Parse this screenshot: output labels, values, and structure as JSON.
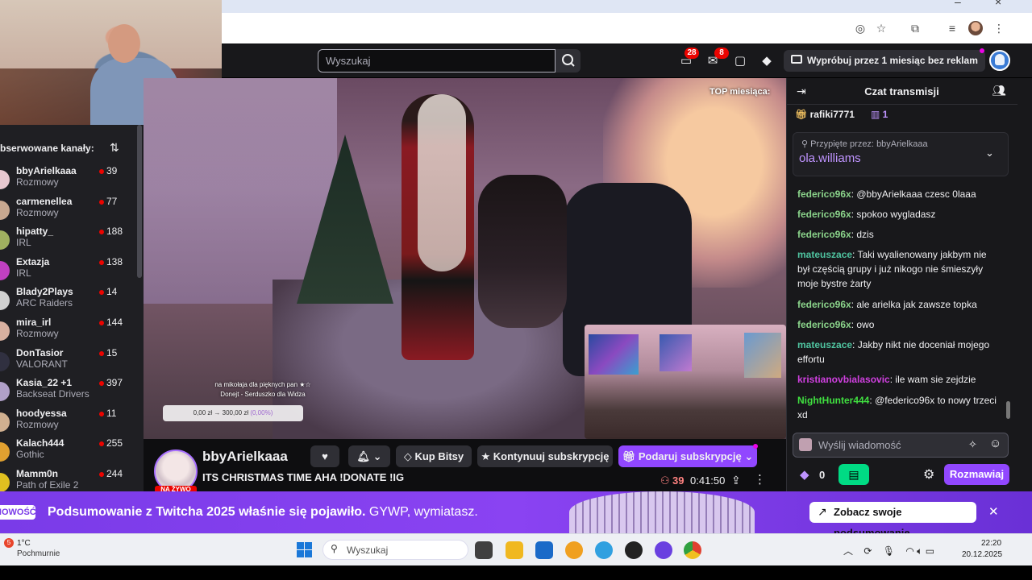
{
  "browser": {
    "icons": [
      "eye-off-icon",
      "star-icon",
      "extensions-icon",
      "media-icon",
      "profile-icon",
      "menu-icon"
    ]
  },
  "topnav": {
    "search_placeholder": "Wyszukaj",
    "notifications_count": "28",
    "inbox_count": "8",
    "trial_label": "Wypróbuj przez 1 miesiąc bez reklam"
  },
  "sidebar": {
    "header": "bserwowane kanały:",
    "channels": [
      {
        "name": "bbyArielkaaa",
        "category": "Rozmowy",
        "viewers": "39",
        "color": "#e8c8d0"
      },
      {
        "name": "carmenellea",
        "category": "Rozmowy",
        "viewers": "77",
        "color": "#c8a890"
      },
      {
        "name": "hipatty_",
        "category": "IRL",
        "viewers": "188",
        "color": "#a0b060"
      },
      {
        "name": "Extazja",
        "category": "IRL",
        "viewers": "138",
        "color": "#c040c0"
      },
      {
        "name": "Blady2Plays",
        "category": "ARC Raiders",
        "viewers": "14",
        "color": "#d0d0d0"
      },
      {
        "name": "mira_irl",
        "category": "Rozmowy",
        "viewers": "144",
        "color": "#d8b0a0"
      },
      {
        "name": "DonTasior",
        "category": "VALORANT",
        "viewers": "15",
        "color": "#303040"
      },
      {
        "name": "Kasia_22 +1",
        "category": "Backseat Drivers",
        "viewers": "397",
        "color": "#b0a0c8"
      },
      {
        "name": "hoodyessa",
        "category": "Rozmowy",
        "viewers": "11",
        "color": "#d0b090"
      },
      {
        "name": "Kalach444",
        "category": "Gothic",
        "viewers": "255",
        "color": "#e0a030"
      },
      {
        "name": "Mamm0n",
        "category": "Path of Exile 2",
        "viewers": "244",
        "color": "#e0c020"
      }
    ]
  },
  "video": {
    "top_title": "TOP miesiąca:",
    "goal_text_1": "na mikołaja dla pięknych pan ★☆",
    "goal_text_2": "Donejt - Serduszko dla Widza",
    "goal_progress": "0,00 zł → 300,00 zł",
    "goal_percent": "(0,00%)"
  },
  "stream": {
    "streamer": "bbyArielkaaa",
    "live_tag": "NA ŻYWO",
    "title": "ITS CHRISTMAS TIME AHA !DONATE !IG",
    "bits_label": "Kup Bitsy",
    "resub_label": "Kontynuuj subskrypcję",
    "gift_label": "Podaruj subskrypcję",
    "viewers": "39",
    "uptime": "0:41:50"
  },
  "chat": {
    "title": "Czat transmisji",
    "gifter": "rafiki7771",
    "gifter_count": "1",
    "pinned_by_label": "Przypięte przez:",
    "pinned_by": "bbyArielkaaa",
    "pinned_user": "ola.williams",
    "messages": [
      {
        "user": "federico96x",
        "text": ": @bbyArielkaaa czesc 0laaa",
        "color": "#8bd48b"
      },
      {
        "user": "federico96x",
        "text": ": spokoo wygladasz",
        "color": "#8bd48b"
      },
      {
        "user": "federico96x",
        "text": ": dzis",
        "color": "#8bd48b"
      },
      {
        "user": "mateuszace",
        "text": ": Taki wyalienowany jakbym nie był częścią grupy i już nikogo nie śmieszyły moje bystre żarty",
        "color": "#4fc4a0"
      },
      {
        "user": "federico96x",
        "text": ": ale arielka jak zawsze topka",
        "color": "#8bd48b"
      },
      {
        "user": "federico96x",
        "text": ": owo",
        "color": "#8bd48b"
      },
      {
        "user": "mateuszace",
        "text": ": Jakby nikt nie doceniał mojego effortu",
        "color": "#4fc4a0"
      },
      {
        "user": "kristianovbialasovic",
        "text": ": ile wam sie zejdzie",
        "color": "#d040e0"
      },
      {
        "user": "NightHunter444",
        "text": ": @federico96x to nowy trzeci xd",
        "color": "#40e040"
      }
    ],
    "input_placeholder": "Wyślij wiadomość",
    "points": "0",
    "send_label": "Rozmawiaj"
  },
  "banner": {
    "tag": "NOWOŚĆ",
    "text_bold": "Podsumowanie z Twitcha 2025 właśnie się pojawiło.",
    "text_rest": " GYWP, wymiatasz.",
    "button": "Zobacz swoje podsumowanie"
  },
  "taskbar": {
    "weather_badge": "5",
    "temperature": "1°C",
    "weather_desc": "Pochmurnie",
    "search_placeholder": "Wyszukaj",
    "time": "22:20",
    "date": "20.12.2025"
  },
  "colors": {
    "accent": "#9147ff",
    "live": "#eb0400",
    "banner": "#7a3be8"
  }
}
